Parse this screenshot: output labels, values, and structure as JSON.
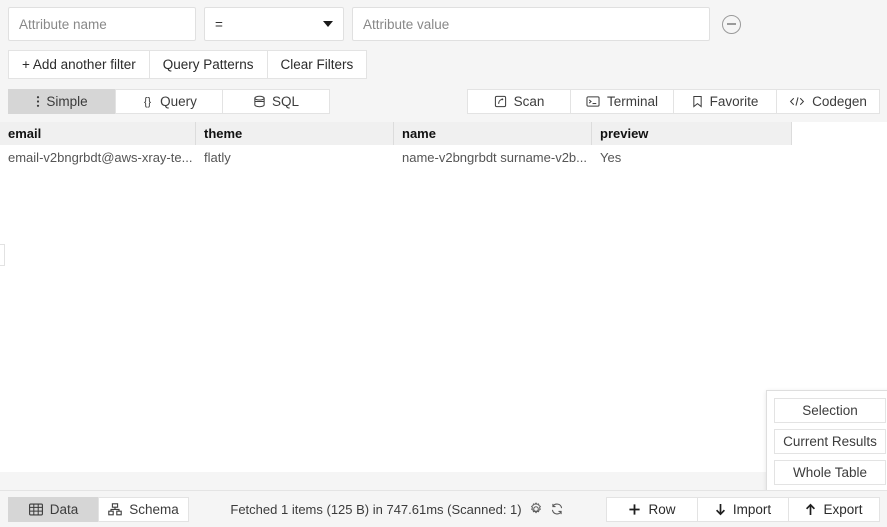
{
  "filter": {
    "attribute_name_placeholder": "Attribute name",
    "operator_value": "=",
    "attribute_value_placeholder": "Attribute value",
    "remove_icon": "minus-circle-icon",
    "actions": [
      {
        "label": "+ Add another filter",
        "name": "add-another-filter-button"
      },
      {
        "label": "Query Patterns",
        "name": "query-patterns-button"
      },
      {
        "label": "Clear Filters",
        "name": "clear-filters-button"
      }
    ]
  },
  "toolbar": {
    "modes": [
      {
        "label": "Simple",
        "icon": "vertical-dots-icon",
        "active": true
      },
      {
        "label": "Query",
        "icon": "braces-icon",
        "active": false
      },
      {
        "label": "SQL",
        "icon": "database-icon",
        "active": false
      }
    ],
    "actions": [
      {
        "label": "Scan",
        "icon": "scan-icon"
      },
      {
        "label": "Terminal",
        "icon": "terminal-icon"
      },
      {
        "label": "Favorite",
        "icon": "bookmark-icon"
      },
      {
        "label": "Codegen",
        "icon": "code-icon"
      }
    ]
  },
  "table": {
    "columns": [
      "email",
      "theme",
      "name",
      "preview"
    ],
    "rows": [
      [
        "email-v2bngrbdt@aws-xray-te...",
        "flatly",
        "name-v2bngrbdt surname-v2b...",
        "Yes"
      ]
    ]
  },
  "dropdown": {
    "items": [
      {
        "label": "Selection",
        "name": "dropdown-item-selection"
      },
      {
        "label": "Current Results",
        "name": "dropdown-item-current-results"
      },
      {
        "label": "Whole Table",
        "name": "dropdown-item-whole-table"
      }
    ]
  },
  "bottom": {
    "views": [
      {
        "label": "Data",
        "icon": "table-icon",
        "active": true
      },
      {
        "label": "Schema",
        "icon": "schema-icon",
        "active": false
      }
    ],
    "status_text": "Fetched 1 items (125 B) in 747.61ms (Scanned: 1)",
    "status_icons": [
      "gear-icon",
      "refresh-icon"
    ],
    "actions": [
      {
        "label": "Row",
        "icon": "plus-icon"
      },
      {
        "label": "Import",
        "icon": "arrow-down-icon"
      },
      {
        "label": "Export",
        "icon": "arrow-up-icon"
      }
    ]
  },
  "colors": {
    "page_background": "#f5f5f5",
    "panel_background": "#ffffff",
    "active_tab": "#d6d6d6",
    "table_header": "#f0f0f0",
    "border": "#e3e3e3",
    "text": "#3c3c3c",
    "muted_text": "#888888"
  }
}
